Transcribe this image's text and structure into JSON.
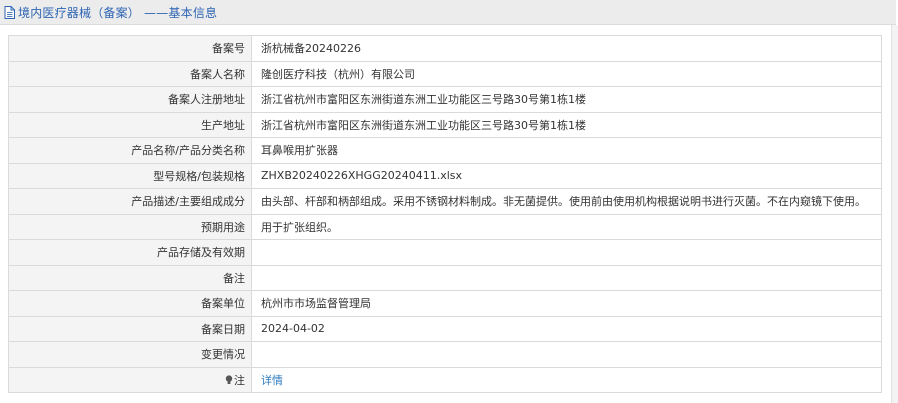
{
  "header": {
    "title": "境内医疗器械（备案） ——基本信息",
    "icon": "document-icon"
  },
  "rows": [
    {
      "label": "备案号",
      "value": "浙杭械备20240226"
    },
    {
      "label": "备案人名称",
      "value": "隆创医疗科技（杭州）有限公司"
    },
    {
      "label": "备案人注册地址",
      "value": "浙江省杭州市富阳区东洲街道东洲工业功能区三号路30号第1栋1楼"
    },
    {
      "label": "生产地址",
      "value": "浙江省杭州市富阳区东洲街道东洲工业功能区三号路30号第1栋1楼"
    },
    {
      "label": "产品名称/产品分类名称",
      "value": "耳鼻喉用扩张器"
    },
    {
      "label": "型号规格/包装规格",
      "value": "ZHXB20240226XHGG20240411.xlsx"
    },
    {
      "label": "产品描述/主要组成成分",
      "value": "由头部、杆部和柄部组成。采用不锈钢材料制成。非无菌提供。使用前由使用机构根据说明书进行灭菌。不在内窥镜下使用。"
    },
    {
      "label": "预期用途",
      "value": "用于扩张组织。"
    },
    {
      "label": "产品存储及有效期",
      "value": ""
    },
    {
      "label": "备注",
      "value": ""
    },
    {
      "label": "备案单位",
      "value": "杭州市市场监督管理局"
    },
    {
      "label": "备案日期",
      "value": "2024-04-02"
    },
    {
      "label": "变更情况",
      "value": ""
    }
  ],
  "note_row": {
    "label": "注",
    "icon": "lightbulb-icon",
    "link_text": "详情"
  },
  "colors": {
    "accent": "#2d64b3",
    "link": "#2d7ac0",
    "label_bg": "#f4f4f4",
    "border": "#dadada"
  }
}
